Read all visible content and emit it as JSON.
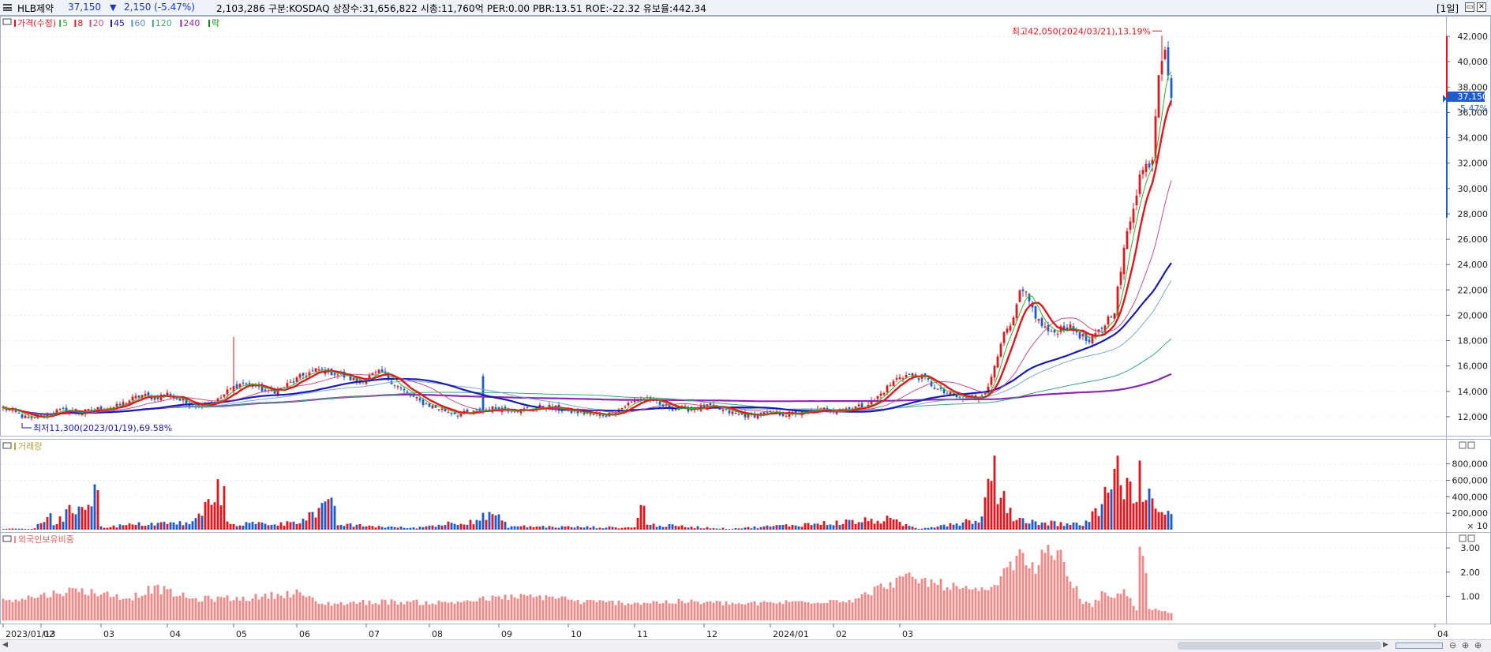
{
  "header": {
    "title": "HLB제약",
    "price": "37,150",
    "arrow": "▼",
    "change": "2,150 (-5.47%)",
    "info": "2,103,286  구분:KOSDAQ 상장수:31,656,822 시총:11,760억  PER:0.00 PBR:13.51 ROE:-22.32 유보율:442.34",
    "period": "[1일]",
    "minimize": "▭",
    "close": "✕"
  },
  "colors": {
    "up": "#e0181e",
    "down": "#1f5cc8",
    "ma5": "#2fb22f",
    "ma8": "#e0181e",
    "ma20": "#c8508a",
    "ma45": "#1a1ab4",
    "ma60": "#7aa8d8",
    "ma120": "#3aa878",
    "ma240": "#8a2ab0",
    "foreign": "#f08a8a",
    "panel_border": "#a8b0c8"
  },
  "price_panel": {
    "legend": [
      {
        "text": "가격(수정)",
        "color": "#e0181e"
      },
      {
        "text": "5",
        "color": "#2fb22f"
      },
      {
        "text": "8",
        "color": "#e0181e"
      },
      {
        "text": "20",
        "color": "#c8508a"
      },
      {
        "text": "45",
        "color": "#1a1ab4"
      },
      {
        "text": "60",
        "color": "#5b8fd0"
      },
      {
        "text": "120",
        "color": "#3aa878"
      },
      {
        "text": "240",
        "color": "#8a2ab0"
      },
      {
        "text": "락",
        "color": "#0a8a0a"
      }
    ],
    "y_ticks": [
      "42,000",
      "40,000",
      "38,000",
      "36,000",
      "34,000",
      "32,000",
      "30,000",
      "28,000",
      "26,000",
      "24,000",
      "22,000",
      "20,000",
      "18,000",
      "16,000",
      "14,000",
      "12,000"
    ],
    "current_price": "37,150",
    "current_change": "-5.47%",
    "high_annotation": "최고42,050(2024/03/21),13.19%",
    "low_annotation": "최저11,300(2023/01/19),69.58%"
  },
  "volume_panel": {
    "legend": "거래량",
    "y_ticks": [
      "800,000",
      "600,000",
      "400,000",
      "200,000"
    ],
    "unit": "× 10"
  },
  "foreign_panel": {
    "legend": "외국인보유비중",
    "y_ticks": [
      "3.00",
      "2.00",
      "1.00"
    ]
  },
  "x_axis": {
    "labels": [
      "2023/01/13",
      "02",
      "03",
      "04",
      "05",
      "06",
      "07",
      "08",
      "09",
      "10",
      "11",
      "12",
      "2024/01",
      "02",
      "03",
      "04"
    ]
  },
  "chart_data": {
    "type": "candlestick",
    "title": "",
    "x_range": [
      "2023/01/13",
      "2024/03/25"
    ],
    "ylim": [
      11000,
      43000
    ],
    "anchors": {
      "close": [
        [
          0,
          12700
        ],
        [
          4,
          12300
        ],
        [
          8,
          11800
        ],
        [
          12,
          12000
        ],
        [
          16,
          12400
        ],
        [
          20,
          12500
        ],
        [
          24,
          12300
        ],
        [
          28,
          12500
        ],
        [
          32,
          12700
        ],
        [
          36,
          12800
        ],
        [
          40,
          13300
        ],
        [
          44,
          13700
        ],
        [
          48,
          13500
        ],
        [
          52,
          13800
        ],
        [
          56,
          13300
        ],
        [
          60,
          12900
        ],
        [
          64,
          13100
        ],
        [
          68,
          13300
        ],
        [
          72,
          14200
        ],
        [
          76,
          14700
        ],
        [
          80,
          14400
        ],
        [
          84,
          13900
        ],
        [
          88,
          14200
        ],
        [
          92,
          14800
        ],
        [
          96,
          15400
        ],
        [
          100,
          15700
        ],
        [
          104,
          15500
        ],
        [
          108,
          15200
        ],
        [
          112,
          14800
        ],
        [
          116,
          15200
        ],
        [
          120,
          15500
        ],
        [
          124,
          14600
        ],
        [
          128,
          13800
        ],
        [
          132,
          13200
        ],
        [
          136,
          12800
        ],
        [
          140,
          12500
        ],
        [
          144,
          12200
        ],
        [
          148,
          12300
        ],
        [
          152,
          12500
        ],
        [
          156,
          12700
        ],
        [
          160,
          12600
        ],
        [
          164,
          12500
        ],
        [
          168,
          12700
        ],
        [
          172,
          12800
        ],
        [
          176,
          12600
        ],
        [
          180,
          12400
        ],
        [
          184,
          12300
        ],
        [
          188,
          12100
        ],
        [
          192,
          12200
        ],
        [
          196,
          12700
        ],
        [
          200,
          13300
        ],
        [
          204,
          13500
        ],
        [
          208,
          12900
        ],
        [
          212,
          12700
        ],
        [
          216,
          12600
        ],
        [
          220,
          12700
        ],
        [
          224,
          12800
        ],
        [
          228,
          12500
        ],
        [
          232,
          12200
        ],
        [
          236,
          12100
        ],
        [
          240,
          12200
        ],
        [
          244,
          12300
        ],
        [
          248,
          12200
        ],
        [
          252,
          12300
        ],
        [
          256,
          12400
        ],
        [
          260,
          12600
        ],
        [
          264,
          12500
        ],
        [
          268,
          12700
        ],
        [
          272,
          12800
        ],
        [
          276,
          13300
        ],
        [
          280,
          14300
        ],
        [
          284,
          15200
        ],
        [
          288,
          15300
        ],
        [
          292,
          15000
        ],
        [
          296,
          14100
        ],
        [
          300,
          13700
        ],
        [
          304,
          13400
        ],
        [
          308,
          13500
        ],
        [
          312,
          14200
        ],
        [
          316,
          18000
        ],
        [
          320,
          19500
        ],
        [
          322,
          21800
        ],
        [
          324,
          21500
        ],
        [
          328,
          19500
        ],
        [
          332,
          18500
        ],
        [
          336,
          19200
        ],
        [
          340,
          18700
        ],
        [
          344,
          17800
        ],
        [
          348,
          19000
        ],
        [
          352,
          20500
        ],
        [
          356,
          26500
        ],
        [
          360,
          31000
        ],
        [
          364,
          32500
        ],
        [
          366,
          39500
        ],
        [
          368,
          41500
        ],
        [
          369,
          39200
        ],
        [
          370,
          37150
        ]
      ],
      "volume": [
        [
          0,
          10
        ],
        [
          10,
          12
        ],
        [
          15,
          200
        ],
        [
          16,
          60
        ],
        [
          30,
          480
        ],
        [
          31,
          30
        ],
        [
          45,
          70
        ],
        [
          60,
          80
        ],
        [
          70,
          530
        ],
        [
          71,
          70
        ],
        [
          90,
          75
        ],
        [
          105,
          290
        ],
        [
          106,
          60
        ],
        [
          130,
          20
        ],
        [
          150,
          120
        ],
        [
          155,
          190
        ],
        [
          160,
          40
        ],
        [
          200,
          25
        ],
        [
          202,
          300
        ],
        [
          203,
          290
        ],
        [
          204,
          60
        ],
        [
          230,
          12
        ],
        [
          280,
          120
        ],
        [
          290,
          12
        ],
        [
          310,
          130
        ],
        [
          314,
          900
        ],
        [
          315,
          310
        ],
        [
          317,
          470
        ],
        [
          318,
          200
        ],
        [
          325,
          100
        ],
        [
          342,
          60
        ],
        [
          348,
          310
        ],
        [
          350,
          450
        ],
        [
          352,
          740
        ],
        [
          354,
          540
        ],
        [
          356,
          630
        ],
        [
          358,
          320
        ],
        [
          360,
          840
        ],
        [
          362,
          360
        ],
        [
          364,
          380
        ],
        [
          370,
          190
        ]
      ],
      "foreign": [
        [
          0,
          0.9
        ],
        [
          10,
          1.0
        ],
        [
          20,
          1.25
        ],
        [
          25,
          1.28
        ],
        [
          40,
          0.95
        ],
        [
          48,
          1.4
        ],
        [
          60,
          0.9
        ],
        [
          70,
          0.95
        ],
        [
          75,
          0.92
        ],
        [
          94,
          1.2
        ],
        [
          100,
          0.7
        ],
        [
          120,
          0.8
        ],
        [
          140,
          0.75
        ],
        [
          160,
          1.0
        ],
        [
          176,
          1.0
        ],
        [
          182,
          0.8
        ],
        [
          200,
          0.75
        ],
        [
          215,
          0.8
        ],
        [
          235,
          0.7
        ],
        [
          270,
          0.9
        ],
        [
          280,
          1.55
        ],
        [
          286,
          1.8
        ],
        [
          295,
          1.6
        ],
        [
          305,
          1.3
        ],
        [
          312,
          1.2
        ],
        [
          318,
          2.1
        ],
        [
          322,
          2.95
        ],
        [
          326,
          2.2
        ],
        [
          330,
          2.8
        ],
        [
          334,
          2.9
        ],
        [
          338,
          1.8
        ],
        [
          342,
          0.8
        ],
        [
          345,
          0.6
        ],
        [
          348,
          1.1
        ],
        [
          352,
          0.9
        ],
        [
          354,
          1.2
        ],
        [
          356,
          1.2
        ],
        [
          357,
          1.0
        ],
        [
          359,
          0.4
        ],
        [
          360,
          3.05
        ],
        [
          362,
          2.0
        ],
        [
          363,
          0.5
        ],
        [
          370,
          0.3
        ]
      ]
    },
    "n_days": 371
  }
}
